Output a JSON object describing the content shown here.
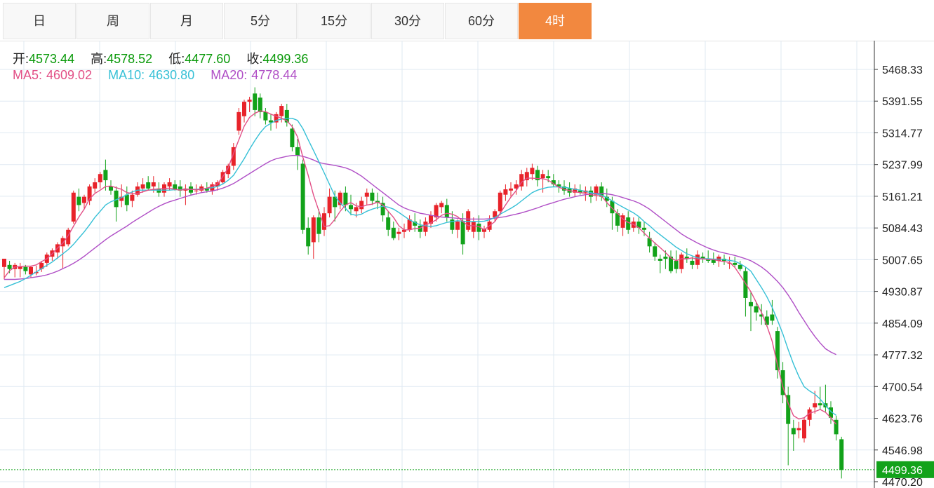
{
  "tabs": [
    {
      "label": "日",
      "active": false
    },
    {
      "label": "周",
      "active": false
    },
    {
      "label": "月",
      "active": false
    },
    {
      "label": "5分",
      "active": false
    },
    {
      "label": "15分",
      "active": false
    },
    {
      "label": "30分",
      "active": false
    },
    {
      "label": "60分",
      "active": false
    },
    {
      "label": "4时",
      "active": true
    }
  ],
  "ohlc": {
    "open_label": "开:",
    "open": "4573.44",
    "high_label": "高:",
    "high": "4578.52",
    "low_label": "低:",
    "low": "4477.60",
    "close_label": "收:",
    "close": "4499.36"
  },
  "ma": {
    "ma5_label": "MA5:",
    "ma5": "4609.02",
    "ma10_label": "MA10:",
    "ma10": "4630.80",
    "ma20_label": "MA20:",
    "ma20": "4778.44"
  },
  "colors": {
    "up": "#e8232a",
    "down": "#12a21a",
    "ma5": "#e24f86",
    "ma10": "#36c0d6",
    "ma20": "#b04fc6",
    "active_tab": "#f2883f",
    "grid": "#dfe9f2",
    "last_price": "#12a21a"
  },
  "chart_data": {
    "type": "candlestick",
    "title": "",
    "ylim": [
      4470.2,
      5500
    ],
    "y_ticks": [
      "5468.33",
      "5391.55",
      "5314.77",
      "5237.99",
      "5161.21",
      "5084.43",
      "5007.65",
      "4930.87",
      "4854.09",
      "4777.32",
      "4700.54",
      "4623.76",
      "4546.98",
      "4470.20"
    ],
    "last_price": "4499.36",
    "grid": true,
    "candles": [
      [
        4990,
        5010,
        4960,
        5010
      ],
      [
        4995,
        5005,
        4975,
        4985
      ],
      [
        4985,
        5000,
        4965,
        4995
      ],
      [
        4985,
        5000,
        4965,
        4992
      ],
      [
        4990,
        4995,
        4972,
        4980
      ],
      [
        4972,
        4992,
        4965,
        4990
      ],
      [
        4975,
        4993,
        4970,
        4978
      ],
      [
        4985,
        5005,
        4978,
        5000
      ],
      [
        5000,
        5025,
        4990,
        5020
      ],
      [
        5015,
        5035,
        5005,
        5030
      ],
      [
        5025,
        5050,
        5010,
        5045
      ],
      [
        5040,
        5065,
        4985,
        5060
      ],
      [
        5045,
        5085,
        5040,
        5080
      ],
      [
        5100,
        5175,
        5095,
        5170
      ],
      [
        5160,
        5180,
        5125,
        5140
      ],
      [
        5145,
        5165,
        5130,
        5160
      ],
      [
        5150,
        5190,
        5140,
        5185
      ],
      [
        5180,
        5205,
        5170,
        5195
      ],
      [
        5195,
        5220,
        5180,
        5215
      ],
      [
        5225,
        5250,
        5175,
        5200
      ],
      [
        5185,
        5200,
        5165,
        5175
      ],
      [
        5175,
        5185,
        5100,
        5135
      ],
      [
        5150,
        5190,
        5135,
        5160
      ],
      [
        5165,
        5185,
        5125,
        5140
      ],
      [
        5150,
        5175,
        5135,
        5165
      ],
      [
        5165,
        5195,
        5160,
        5185
      ],
      [
        5180,
        5205,
        5170,
        5190
      ],
      [
        5195,
        5210,
        5175,
        5180
      ],
      [
        5185,
        5210,
        5170,
        5195
      ],
      [
        5180,
        5195,
        5160,
        5170
      ],
      [
        5170,
        5195,
        5160,
        5190
      ],
      [
        5185,
        5205,
        5175,
        5195
      ],
      [
        5190,
        5200,
        5175,
        5178
      ],
      [
        5185,
        5200,
        5160,
        5175
      ],
      [
        5175,
        5190,
        5140,
        5180
      ],
      [
        5185,
        5195,
        5165,
        5170
      ],
      [
        5175,
        5190,
        5165,
        5175
      ],
      [
        5175,
        5190,
        5170,
        5185
      ],
      [
        5180,
        5195,
        5170,
        5175
      ],
      [
        5175,
        5195,
        5165,
        5190
      ],
      [
        5185,
        5200,
        5175,
        5195
      ],
      [
        5195,
        5225,
        5190,
        5220
      ],
      [
        5215,
        5240,
        5205,
        5235
      ],
      [
        5235,
        5290,
        5225,
        5280
      ],
      [
        5320,
        5375,
        5310,
        5365
      ],
      [
        5355,
        5395,
        5340,
        5390
      ],
      [
        5390,
        5402,
        5365,
        5395
      ],
      [
        5410,
        5425,
        5355,
        5370
      ],
      [
        5400,
        5410,
        5350,
        5365
      ],
      [
        5365,
        5375,
        5335,
        5345
      ],
      [
        5345,
        5360,
        5320,
        5340
      ],
      [
        5340,
        5365,
        5325,
        5360
      ],
      [
        5355,
        5385,
        5340,
        5380
      ],
      [
        5370,
        5385,
        5330,
        5340
      ],
      [
        5325,
        5335,
        5270,
        5280
      ],
      [
        5280,
        5300,
        5225,
        5260
      ],
      [
        5240,
        5250,
        5070,
        5080
      ],
      [
        5085,
        5110,
        5020,
        5040
      ],
      [
        5050,
        5115,
        5010,
        5110
      ],
      [
        5110,
        5130,
        5050,
        5070
      ],
      [
        5080,
        5135,
        5065,
        5120
      ],
      [
        5120,
        5180,
        5110,
        5160
      ],
      [
        5160,
        5175,
        5100,
        5135
      ],
      [
        5140,
        5175,
        5130,
        5170
      ],
      [
        5170,
        5185,
        5125,
        5140
      ],
      [
        5140,
        5165,
        5115,
        5130
      ],
      [
        5125,
        5145,
        5110,
        5135
      ],
      [
        5130,
        5160,
        5120,
        5150
      ],
      [
        5160,
        5180,
        5140,
        5170
      ],
      [
        5170,
        5180,
        5140,
        5150
      ],
      [
        5150,
        5170,
        5130,
        5145
      ],
      [
        5145,
        5160,
        5100,
        5115
      ],
      [
        5110,
        5125,
        5065,
        5080
      ],
      [
        5085,
        5100,
        5055,
        5060
      ],
      [
        5070,
        5085,
        5055,
        5075
      ],
      [
        5075,
        5095,
        5060,
        5080
      ],
      [
        5080,
        5115,
        5075,
        5105
      ],
      [
        5100,
        5120,
        5075,
        5090
      ],
      [
        5090,
        5105,
        5060,
        5075
      ],
      [
        5075,
        5110,
        5065,
        5100
      ],
      [
        5095,
        5125,
        5085,
        5115
      ],
      [
        5110,
        5145,
        5100,
        5140
      ],
      [
        5135,
        5150,
        5120,
        5145
      ],
      [
        5140,
        5155,
        5100,
        5110
      ],
      [
        5105,
        5125,
        5070,
        5080
      ],
      [
        5080,
        5105,
        5060,
        5100
      ],
      [
        5100,
        5120,
        5020,
        5045
      ],
      [
        5080,
        5130,
        5075,
        5125
      ],
      [
        5075,
        5110,
        5060,
        5100
      ],
      [
        5095,
        5115,
        5055,
        5075
      ],
      [
        5075,
        5090,
        5060,
        5082
      ],
      [
        5080,
        5115,
        5075,
        5100
      ],
      [
        5110,
        5130,
        5100,
        5125
      ],
      [
        5125,
        5175,
        5115,
        5170
      ],
      [
        5165,
        5190,
        5150,
        5178
      ],
      [
        5175,
        5195,
        5160,
        5180
      ],
      [
        5180,
        5200,
        5165,
        5190
      ],
      [
        5185,
        5225,
        5175,
        5215
      ],
      [
        5200,
        5230,
        5185,
        5220
      ],
      [
        5215,
        5240,
        5200,
        5230
      ],
      [
        5225,
        5235,
        5185,
        5200
      ],
      [
        5205,
        5225,
        5170,
        5215
      ],
      [
        5210,
        5225,
        5195,
        5205
      ],
      [
        5200,
        5215,
        5185,
        5190
      ],
      [
        5190,
        5200,
        5170,
        5185
      ],
      [
        5185,
        5200,
        5165,
        5175
      ],
      [
        5180,
        5195,
        5160,
        5170
      ],
      [
        5170,
        5190,
        5160,
        5180
      ],
      [
        5175,
        5190,
        5165,
        5170
      ],
      [
        5170,
        5185,
        5150,
        5175
      ],
      [
        5175,
        5185,
        5145,
        5160
      ],
      [
        5165,
        5190,
        5150,
        5185
      ],
      [
        5185,
        5195,
        5150,
        5160
      ],
      [
        5160,
        5180,
        5135,
        5150
      ],
      [
        5150,
        5160,
        5080,
        5120
      ],
      [
        5120,
        5130,
        5075,
        5090
      ],
      [
        5085,
        5120,
        5065,
        5115
      ],
      [
        5110,
        5125,
        5070,
        5080
      ],
      [
        5085,
        5110,
        5075,
        5100
      ],
      [
        5100,
        5110,
        5070,
        5085
      ],
      [
        5085,
        5100,
        5065,
        5080
      ],
      [
        5060,
        5075,
        5025,
        5040
      ],
      [
        5040,
        5050,
        5005,
        5015
      ],
      [
        5010,
        5020,
        4975,
        5005
      ],
      [
        5015,
        5030,
        4985,
        5010
      ],
      [
        5015,
        5030,
        4975,
        4980
      ],
      [
        5005,
        5030,
        4975,
        4985
      ],
      [
        4985,
        5025,
        4975,
        5020
      ],
      [
        5015,
        5035,
        5000,
        5010
      ],
      [
        5005,
        5015,
        4985,
        4995
      ],
      [
        4995,
        5030,
        4985,
        5020
      ],
      [
        5015,
        5025,
        5000,
        5010
      ],
      [
        5010,
        5030,
        5000,
        5005
      ],
      [
        5010,
        5025,
        4995,
        5000
      ],
      [
        5005,
        5020,
        4990,
        5015
      ],
      [
        5010,
        5020,
        4995,
        5005
      ],
      [
        5000,
        5015,
        4985,
        5000
      ],
      [
        5000,
        5015,
        4990,
        4995
      ],
      [
        4995,
        5005,
        4980,
        4985
      ],
      [
        4980,
        4990,
        4870,
        4915
      ],
      [
        4905,
        4930,
        4835,
        4895
      ],
      [
        4895,
        4905,
        4860,
        4880
      ],
      [
        4875,
        4900,
        4850,
        4870
      ],
      [
        4870,
        4885,
        4845,
        4850
      ],
      [
        4875,
        4910,
        4850,
        4860
      ],
      [
        4835,
        4845,
        4720,
        4740
      ],
      [
        4740,
        4760,
        4660,
        4680
      ],
      [
        4680,
        4700,
        4510,
        4610
      ],
      [
        4600,
        4620,
        4545,
        4585
      ],
      [
        4595,
        4615,
        4575,
        4600
      ],
      [
        4575,
        4625,
        4565,
        4620
      ],
      [
        4620,
        4650,
        4605,
        4645
      ],
      [
        4650,
        4690,
        4635,
        4660
      ],
      [
        4660,
        4700,
        4645,
        4655
      ],
      [
        4660,
        4705,
        4640,
        4650
      ],
      [
        4650,
        4665,
        4610,
        4625
      ],
      [
        4620,
        4630,
        4570,
        4585
      ],
      [
        4573,
        4579,
        4478,
        4499
      ]
    ],
    "ma5": [
      4964,
      4981,
      4990,
      4991,
      4992,
      4992,
      4995,
      5003,
      5010,
      5022,
      5036,
      5048,
      5066,
      5089,
      5111,
      5130,
      5155,
      5168,
      5176,
      5185,
      5186,
      5182,
      5178,
      5170,
      5168,
      5168,
      5172,
      5176,
      5178,
      5179,
      5180,
      5181,
      5178,
      5176,
      5178,
      5178,
      5177,
      5178,
      5181,
      5185,
      5191,
      5209,
      5230,
      5265,
      5298,
      5331,
      5352,
      5362,
      5368,
      5366,
      5360,
      5355,
      5350,
      5344,
      5330,
      5305,
      5256,
      5212,
      5164,
      5126,
      5088,
      5090,
      5105,
      5125,
      5140,
      5146,
      5138,
      5136,
      5140,
      5142,
      5147,
      5140,
      5125,
      5110,
      5090,
      5080,
      5080,
      5083,
      5084,
      5092,
      5097,
      5104,
      5115,
      5120,
      5118,
      5112,
      5100,
      5090,
      5090,
      5088,
      5080,
      5090,
      5100,
      5120,
      5140,
      5159,
      5175,
      5195,
      5205,
      5205,
      5204,
      5204,
      5200,
      5192,
      5183,
      5178,
      5175,
      5172,
      5170,
      5168,
      5165,
      5163,
      5162,
      5146,
      5132,
      5120,
      5106,
      5098,
      5093,
      5085,
      5072,
      5060,
      5048,
      5037,
      5025,
      5012,
      5005,
      5010,
      5010,
      5012,
      5009,
      5010,
      5008,
      5008,
      5005,
      5003,
      5001,
      4989,
      4970,
      4950,
      4930,
      4905,
      4880,
      4848,
      4810,
      4752,
      4700,
      4660,
      4630,
      4622,
      4625,
      4636,
      4640,
      4645,
      4638,
      4625,
      4609
    ],
    "ma10": [
      4940,
      4945,
      4950,
      4955,
      4962,
      4970,
      4978,
      4986,
      4994,
      5002,
      5012,
      5022,
      5032,
      5045,
      5060,
      5075,
      5092,
      5110,
      5125,
      5140,
      5148,
      5153,
      5158,
      5165,
      5172,
      5176,
      5176,
      5176,
      5176,
      5176,
      5176,
      5176,
      5177,
      5177,
      5178,
      5178,
      5178,
      5179,
      5180,
      5182,
      5185,
      5191,
      5200,
      5212,
      5232,
      5252,
      5275,
      5296,
      5315,
      5330,
      5338,
      5345,
      5348,
      5350,
      5350,
      5345,
      5325,
      5298,
      5272,
      5245,
      5218,
      5190,
      5162,
      5145,
      5132,
      5118,
      5115,
      5118,
      5125,
      5130,
      5134,
      5137,
      5135,
      5130,
      5122,
      5113,
      5104,
      5098,
      5092,
      5090,
      5088,
      5090,
      5094,
      5098,
      5100,
      5102,
      5101,
      5100,
      5100,
      5100,
      5101,
      5104,
      5110,
      5118,
      5125,
      5132,
      5140,
      5150,
      5160,
      5170,
      5176,
      5180,
      5183,
      5184,
      5184,
      5183,
      5181,
      5178,
      5176,
      5173,
      5170,
      5167,
      5164,
      5158,
      5150,
      5142,
      5135,
      5128,
      5121,
      5112,
      5100,
      5090,
      5078,
      5068,
      5058,
      5048,
      5038,
      5030,
      5022,
      5017,
      5012,
      5010,
      5010,
      5009,
      5009,
      5008,
      5006,
      5004,
      4998,
      4990,
      4980,
      4960,
      4940,
      4918,
      4892,
      4861,
      4828,
      4790,
      4755,
      4725,
      4700,
      4690,
      4682,
      4670,
      4655,
      4640,
      4631
    ],
    "ma20": [
      4960,
      4960,
      4960,
      4961,
      4962,
      4964,
      4966,
      4968,
      4971,
      4975,
      4980,
      4986,
      4992,
      4999,
      5007,
      5016,
      5026,
      5036,
      5046,
      5056,
      5065,
      5073,
      5081,
      5089,
      5098,
      5106,
      5114,
      5122,
      5130,
      5137,
      5143,
      5148,
      5152,
      5156,
      5160,
      5164,
      5167,
      5170,
      5172,
      5174,
      5177,
      5181,
      5186,
      5192,
      5200,
      5208,
      5216,
      5224,
      5232,
      5240,
      5247,
      5252,
      5255,
      5258,
      5260,
      5260,
      5258,
      5254,
      5249,
      5243,
      5240,
      5238,
      5236,
      5233,
      5230,
      5225,
      5218,
      5210,
      5200,
      5190,
      5180,
      5170,
      5160,
      5150,
      5140,
      5133,
      5128,
      5124,
      5120,
      5118,
      5115,
      5113,
      5111,
      5110,
      5109,
      5108,
      5107,
      5106,
      5106,
      5106,
      5106,
      5107,
      5108,
      5110,
      5112,
      5115,
      5118,
      5121,
      5125,
      5129,
      5133,
      5138,
      5142,
      5146,
      5150,
      5154,
      5157,
      5160,
      5163,
      5165,
      5167,
      5168,
      5168,
      5167,
      5165,
      5162,
      5158,
      5154,
      5150,
      5145,
      5138,
      5130,
      5120,
      5110,
      5100,
      5090,
      5080,
      5070,
      5062,
      5055,
      5048,
      5042,
      5036,
      5031,
      5027,
      5024,
      5021,
      5018,
      5014,
      5010,
      5005,
      4998,
      4990,
      4980,
      4968,
      4955,
      4940,
      4922,
      4902,
      4880,
      4860,
      4840,
      4822,
      4806,
      4792,
      4784,
      4778
    ]
  }
}
